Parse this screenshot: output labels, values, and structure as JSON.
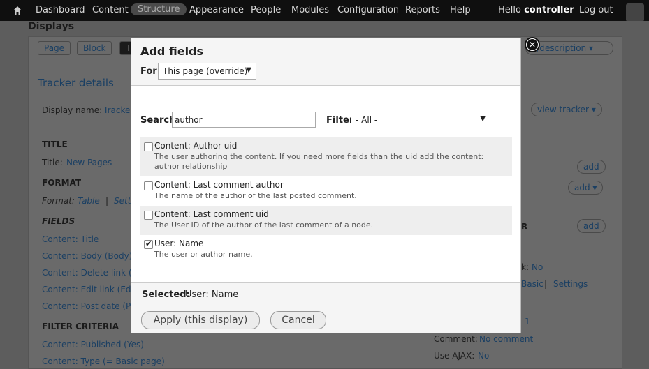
{
  "toolbar": {
    "items": [
      "Dashboard",
      "Content",
      "Structure",
      "Appearance",
      "People",
      "Modules",
      "Configuration",
      "Reports",
      "Help"
    ],
    "active": "Structure",
    "hello_prefix": "Hello",
    "username": "controller",
    "logout": "Log out"
  },
  "background": {
    "heading": "Displays",
    "tabs": [
      "Page",
      "Block",
      "T"
    ],
    "tracker_details": "Tracker details",
    "display_name_label": "Display name:",
    "display_name_value": "Tracke",
    "title_head": "TITLE",
    "title_label": "Title:",
    "title_value": "New Pages",
    "format_head": "FORMAT",
    "format_label": "Format:",
    "format_value": "Table",
    "format_sep": "|",
    "format_settings": "Sett",
    "fields_head": "FIELDS",
    "fields": [
      "Content: Title",
      "Content: Body (Body)",
      "Content: Delete link (D",
      "Content: Edit link (Edi",
      "Content: Post date (Po"
    ],
    "filter_head": "FILTER CRITERIA",
    "filters": [
      "Content: Published (Yes)",
      "Content: Type (= Basic page)"
    ],
    "right_dropdown": "e/description",
    "view_tracker": "view tracker",
    "add": "add",
    "r_letter": "R",
    "use_pager_value": "No",
    "k_colon": "k:",
    "basic": "Basic",
    "settings": "Settings",
    "num": "1",
    "comment_label": "Comment:",
    "comment_value": "No comment",
    "ajax_label": "Use AJAX:",
    "ajax_value": "No"
  },
  "modal": {
    "title": "Add fields",
    "for_label": "For",
    "for_value": "This page (override)",
    "search_label": "Search",
    "search_value": "author",
    "filter_label": "Filter",
    "filter_value": "- All -",
    "fields": [
      {
        "name": "Content: Author uid",
        "desc": "The user authoring the content. If you need more fields than the uid add the content: author relationship",
        "checked": false
      },
      {
        "name": "Content: Last comment author",
        "desc": "The name of the author of the last posted comment.",
        "checked": false
      },
      {
        "name": "Content: Last comment uid",
        "desc": "The User ID of the author of the last comment of a node.",
        "checked": false
      },
      {
        "name": "User: Name",
        "desc": "The user or author name.",
        "checked": true
      }
    ],
    "selected_label": "Selected:",
    "selected_value": "User: Name",
    "apply_label": "Apply (this display)",
    "cancel_label": "Cancel"
  }
}
